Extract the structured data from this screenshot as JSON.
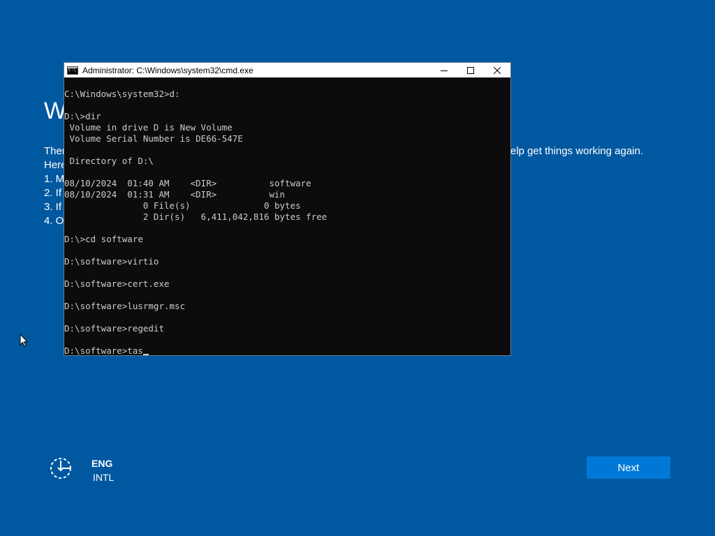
{
  "background": {
    "title": "W",
    "lines": [
      "Ther",
      "Here",
      "1. M",
      "2. If",
      "3. If",
      "4. O"
    ],
    "line_right": "elp get things working again."
  },
  "cmd_window": {
    "title": "Administrator: C:\\Windows\\system32\\cmd.exe",
    "controls": {
      "minimize": "—",
      "maximize": "☐",
      "close": "✕"
    },
    "console_lines": [
      "C:\\Windows\\system32>d:",
      "",
      "D:\\>dir",
      " Volume in drive D is New Volume",
      " Volume Serial Number is DE66-547E",
      "",
      " Directory of D:\\",
      "",
      "08/10/2024  01:40 AM    <DIR>          software",
      "08/10/2024  01:31 AM    <DIR>          win",
      "               0 File(s)              0 bytes",
      "               2 Dir(s)   6,411,042,816 bytes free",
      "",
      "D:\\>cd software",
      "",
      "D:\\software>virtio",
      "",
      "D:\\software>cert.exe",
      "",
      "D:\\software>lusrmgr.msc",
      "",
      "D:\\software>regedit",
      ""
    ],
    "current_input": "D:\\software>tas"
  },
  "footer": {
    "language_code": "ENG",
    "keyboard_layout": "INTL",
    "next_label": "Next"
  },
  "icons": {
    "accessibility": "ease-of-access-icon",
    "window": "cmd-icon",
    "pointer": "mouse-pointer-icon"
  },
  "colors": {
    "background": "#0058a0",
    "next_button": "#0078d7",
    "console_bg": "#0c0c0c",
    "console_text": "#cccccc"
  }
}
